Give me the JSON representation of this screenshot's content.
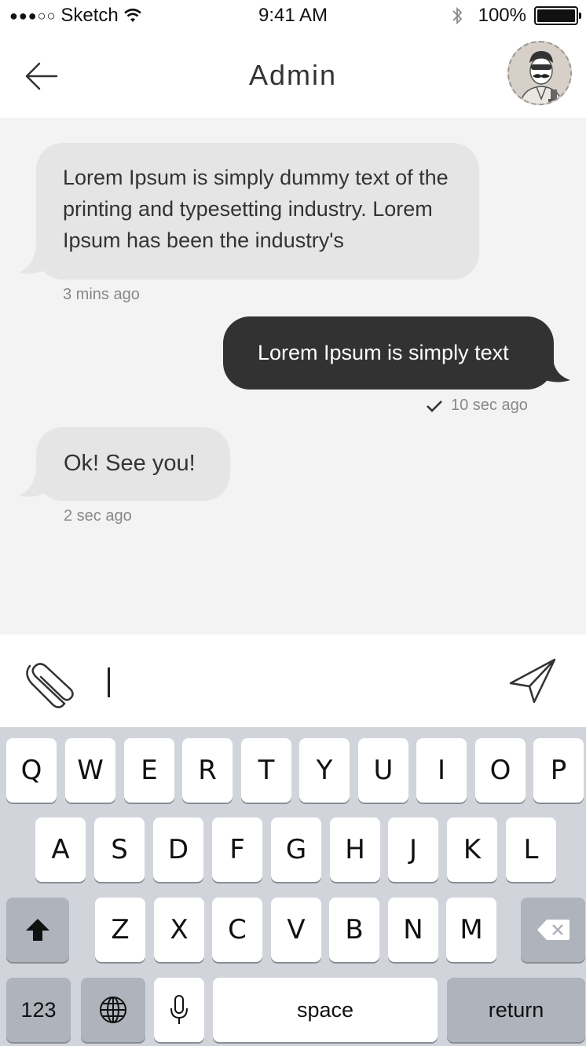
{
  "status_bar": {
    "signal": "●●●○○",
    "carrier": "Sketch",
    "time": "9:41 AM",
    "battery": "100%",
    "icons": [
      "wifi-icon",
      "bluetooth-icon",
      "battery-icon"
    ]
  },
  "nav": {
    "title": "Admin",
    "back_icon": "arrow-left-icon",
    "avatar_icon": "admin-avatar"
  },
  "messages": [
    {
      "direction": "incoming",
      "text": "Lorem Ipsum is simply dummy text of the printing and typesetting industry. Lorem Ipsum has been the industry's",
      "time": "3 mins ago"
    },
    {
      "direction": "outgoing",
      "text": "Lorem Ipsum is simply text",
      "time": "10 sec ago",
      "status_icon": "checkmark-icon"
    },
    {
      "direction": "incoming",
      "text": "Ok! See you!",
      "time": "2 sec ago"
    }
  ],
  "composer": {
    "value": "",
    "attach_icon": "paperclip-icon",
    "send_icon": "send-icon"
  },
  "keyboard": {
    "row1": [
      "Q",
      "W",
      "E",
      "R",
      "T",
      "Y",
      "U",
      "I",
      "O",
      "P"
    ],
    "row2": [
      "A",
      "S",
      "D",
      "F",
      "G",
      "H",
      "J",
      "K",
      "L"
    ],
    "row3": [
      "Z",
      "X",
      "C",
      "V",
      "B",
      "N",
      "M"
    ],
    "numbers": "123",
    "space": "space",
    "return": "return",
    "icons": [
      "shift-icon",
      "backspace-icon",
      "globe-icon",
      "microphone-icon"
    ]
  },
  "colors": {
    "chat_background": "#f3f3f3",
    "incoming_bubble": "#e5e5e5",
    "outgoing_bubble": "#323232",
    "keyboard_background": "#d1d5db"
  }
}
